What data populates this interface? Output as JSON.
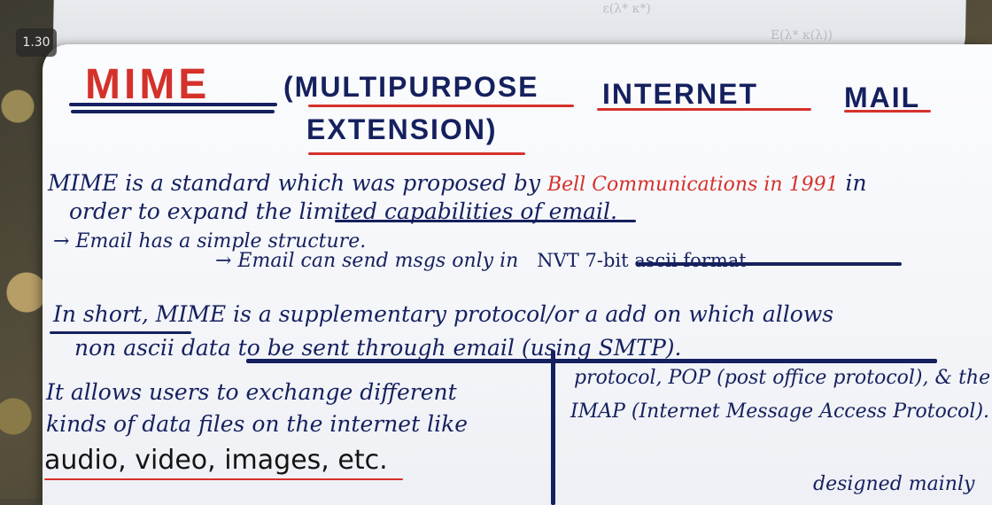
{
  "overlay": {
    "speed": "1.30"
  },
  "title": {
    "mime": "MIME",
    "line1": [
      "(MULTIPURPOSE",
      "INTERNET",
      "MAIL"
    ],
    "line2": "EXTENSION)"
  },
  "para1": {
    "line1_start": "MIME is a standard which was proposed by",
    "line1_red": "Bell Communications in 1991",
    "line1_end": "in",
    "line2": "order to expand the limited capabilities of email."
  },
  "notes": {
    "n1": "→ Email has a simple structure.",
    "n2_start": "→ Email can send msgs only in",
    "n2_hl": "NVT 7-bit ascii format"
  },
  "para2": {
    "line1": "In short, MIME is a supplementary protocol/or a add on which allows",
    "line2": "non ascii data to be sent through email (using SMTP)."
  },
  "left_col": {
    "line1": "It allows users to exchange different",
    "line2": "kinds of data files on the internet like",
    "line3": "audio, video, images, etc."
  },
  "right_col": {
    "line1": "protocol, POP (post office protocol), & the",
    "line2": "IMAP (Internet Message Access Protocol).",
    "line3": "designed mainly"
  }
}
